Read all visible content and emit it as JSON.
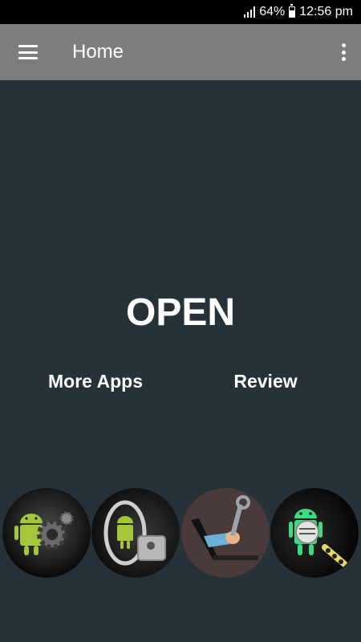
{
  "status_bar": {
    "battery": "64%",
    "time": "12:56 pm"
  },
  "app_bar": {
    "title": "Home"
  },
  "main": {
    "open_label": "OPEN",
    "more_apps_label": "More Apps",
    "review_label": "Review"
  },
  "apps": [
    {
      "icon": "android-gear-icon"
    },
    {
      "icon": "android-vault-icon"
    },
    {
      "icon": "laptop-wrench-icon"
    },
    {
      "icon": "android-scanner-icon"
    }
  ],
  "colors": {
    "background": "#263238",
    "app_bar": "#7d7d7d",
    "status_bar": "#000000",
    "text": "#ffffff"
  }
}
